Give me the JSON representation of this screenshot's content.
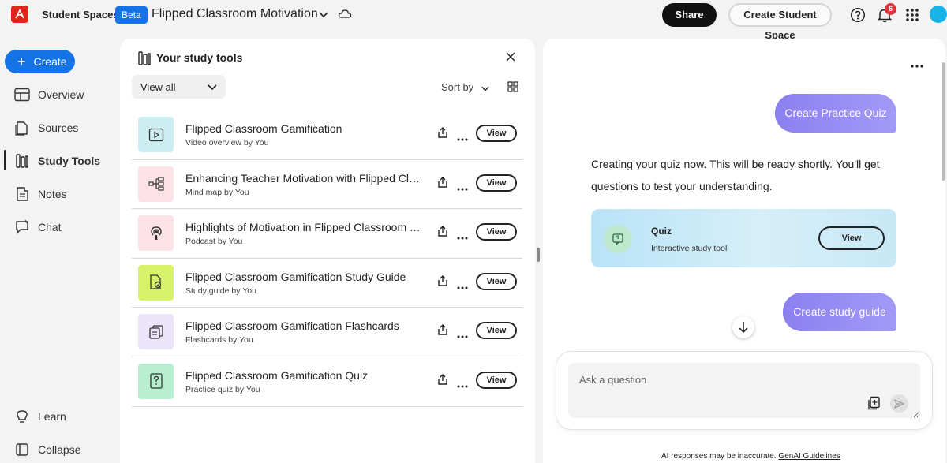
{
  "header": {
    "app_name": "Student Spaces",
    "beta_label": "Beta",
    "space_title": "Flipped Classroom Motivation",
    "share_label": "Share",
    "create_space_label": "Create Student Space",
    "notification_count": "6"
  },
  "sidebar": {
    "create_label": "Create",
    "items": [
      {
        "label": "Overview",
        "icon": "overview-icon"
      },
      {
        "label": "Sources",
        "icon": "sources-icon"
      },
      {
        "label": "Study Tools",
        "icon": "study-tools-icon",
        "active": true
      },
      {
        "label": "Notes",
        "icon": "notes-icon"
      },
      {
        "label": "Chat",
        "icon": "chat-icon"
      }
    ],
    "learn_label": "Learn",
    "collapse_label": "Collapse"
  },
  "tools": {
    "title": "Your study tools",
    "filter_value": "View all",
    "sort_label": "Sort by",
    "view_label": "View",
    "items": [
      {
        "title": "Flipped Classroom Gamification",
        "subtitle": "Video overview by You",
        "icon": "video-icon",
        "color": "#cdeef0"
      },
      {
        "title": "Enhancing Teacher Motivation with Flipped Classroom",
        "subtitle": "Mind map by You",
        "icon": "mind-map-icon",
        "color": "#fde3e8"
      },
      {
        "title": "Highlights of Motivation in Flipped Classroom Teaching",
        "subtitle": "Podcast by You",
        "icon": "podcast-icon",
        "color": "#fde3e8"
      },
      {
        "title": "Flipped Classroom Gamification Study Guide",
        "subtitle": "Study guide by You",
        "icon": "study-guide-icon",
        "color": "#d8f36a"
      },
      {
        "title": "Flipped Classroom Gamification Flashcards",
        "subtitle": "Flashcards by You",
        "icon": "flashcards-icon",
        "color": "#ebe4fb"
      },
      {
        "title": "Flipped Classroom Gamification Quiz",
        "subtitle": "Practice quiz by You",
        "icon": "quiz-icon",
        "color": "#b8efd0"
      }
    ]
  },
  "chat": {
    "user_message_1": "Create Practice Quiz",
    "ai_response": "Creating your quiz now. This will be ready shortly. You'll get questions to test your understanding.",
    "quiz_card": {
      "title": "Quiz",
      "subtitle": "Interactive study tool",
      "view_label": "View"
    },
    "user_message_2": "Create study guide",
    "input_placeholder": "Ask a question",
    "disclaimer": "AI responses may be inaccurate.",
    "guidelines_link": "GenAI Guidelines"
  }
}
